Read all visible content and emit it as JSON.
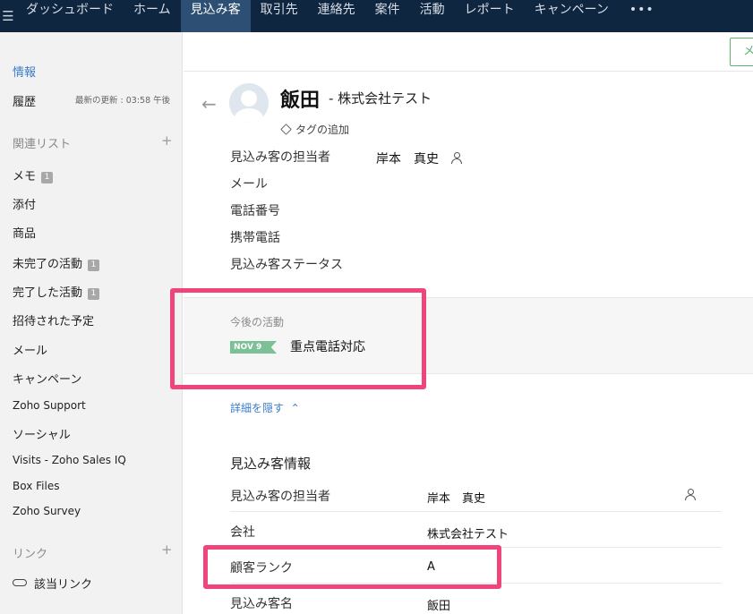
{
  "topnav": {
    "menu_icon": "☰",
    "tabs": [
      "ダッシュボード",
      "ホーム",
      "見込み客",
      "取引先",
      "連絡先",
      "案件",
      "活動",
      "レポート",
      "キャンペーン"
    ],
    "more": "•••"
  },
  "sidebar": {
    "info": "情報",
    "history": "履歴",
    "last_update": "最新の更新 : 03:58 午後",
    "related_list": "関連リスト",
    "add_related": "+",
    "items": {
      "memo": "メモ",
      "memo_count": "1",
      "attachments": "添付",
      "products": "商品",
      "open_activities": "未完了の活動",
      "open_activities_count": "1",
      "closed_activities": "完了した活動",
      "closed_activities_count": "1",
      "invited_events": "招待された予定",
      "mail": "メール",
      "campaigns": "キャンペーン",
      "zoho_support": "Zoho Support",
      "social": "ソーシャル",
      "visits": "Visits - Zoho Sales IQ",
      "box_files": "Box Files",
      "zoho_survey": "Zoho Survey"
    },
    "links_title": "リンク",
    "add_link": "+",
    "related_link": "該当リンク"
  },
  "header": {
    "top_button": "メ",
    "back_arrow": "←",
    "name": "飯田",
    "company": "- 株式会社テスト",
    "add_tag": "タグの追加"
  },
  "summary": {
    "owner_label": "見込み客の担当者",
    "owner_value": "岸本　真史",
    "email_label": "メール",
    "phone_label": "電話番号",
    "mobile_label": "携帯電話",
    "status_label": "見込み客ステータス"
  },
  "activities": {
    "title": "今後の活動",
    "date_tag": "NOV 9",
    "name": "重点電話対応"
  },
  "details": {
    "hide_label": "詳細を隠す",
    "chevron": "⌃",
    "section_title": "見込み客情報",
    "rows": [
      {
        "label": "見込み客の担当者",
        "value": "岸本　真史"
      },
      {
        "label": "会社",
        "value": "株式会社テスト"
      },
      {
        "label": "顧客ランク",
        "value": "A"
      },
      {
        "label": "見込み客名",
        "value": "飯田"
      }
    ]
  },
  "colors": {
    "nav_bg": "#0f2640",
    "nav_active": "#2d4f73",
    "highlight": "#f0457a",
    "tag_green": "#7bc096",
    "link_blue": "#3d7cc9"
  }
}
